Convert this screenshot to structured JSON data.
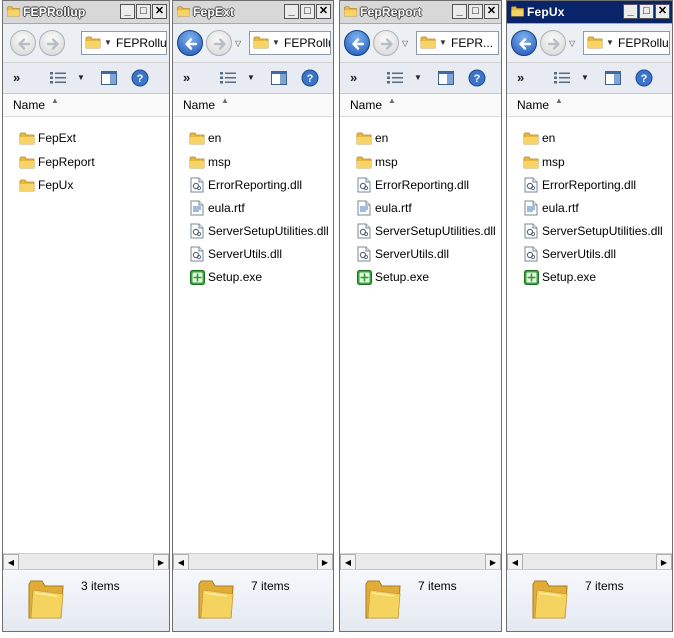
{
  "windows": [
    {
      "title": "FEPRollup",
      "active": false,
      "back_enabled": false,
      "address": "FEPRollup",
      "column_header": "Name",
      "items": [
        {
          "label": "FepExt",
          "type": "folder"
        },
        {
          "label": "FepReport",
          "type": "folder"
        },
        {
          "label": "FepUx",
          "type": "folder"
        }
      ],
      "status_count": "3 items"
    },
    {
      "title": "FepExt",
      "active": false,
      "back_enabled": true,
      "address": "FEPRollu",
      "column_header": "Name",
      "items": [
        {
          "label": "en",
          "type": "folder"
        },
        {
          "label": "msp",
          "type": "folder"
        },
        {
          "label": "ErrorReporting.dll",
          "type": "dll"
        },
        {
          "label": "eula.rtf",
          "type": "rtf"
        },
        {
          "label": "ServerSetupUtilities.dll",
          "type": "dll"
        },
        {
          "label": "ServerUtils.dll",
          "type": "dll"
        },
        {
          "label": "Setup.exe",
          "type": "exe"
        }
      ],
      "status_count": "7 items"
    },
    {
      "title": "FepReport",
      "active": false,
      "back_enabled": true,
      "address": "FEPR...",
      "column_header": "Name",
      "items": [
        {
          "label": "en",
          "type": "folder"
        },
        {
          "label": "msp",
          "type": "folder"
        },
        {
          "label": "ErrorReporting.dll",
          "type": "dll"
        },
        {
          "label": "eula.rtf",
          "type": "rtf"
        },
        {
          "label": "ServerSetupUtilities.dll",
          "type": "dll"
        },
        {
          "label": "ServerUtils.dll",
          "type": "dll"
        },
        {
          "label": "Setup.exe",
          "type": "exe"
        }
      ],
      "status_count": "7 items"
    },
    {
      "title": "FepUx",
      "active": true,
      "back_enabled": true,
      "address": "FEPRollup",
      "column_header": "Name",
      "items": [
        {
          "label": "en",
          "type": "folder"
        },
        {
          "label": "msp",
          "type": "folder"
        },
        {
          "label": "ErrorReporting.dll",
          "type": "dll"
        },
        {
          "label": "eula.rtf",
          "type": "rtf"
        },
        {
          "label": "ServerSetupUtilities.dll",
          "type": "dll"
        },
        {
          "label": "ServerUtils.dll",
          "type": "dll"
        },
        {
          "label": "Setup.exe",
          "type": "exe"
        }
      ],
      "status_count": "7 items"
    }
  ],
  "toolbar": {
    "more_label": "»",
    "help_label": "?"
  },
  "title_buttons": {
    "minimize": "_",
    "maximize": "□",
    "close": "✕"
  },
  "icons": {
    "folder": "folder-icon",
    "dll": "dll-file-icon",
    "rtf": "rtf-file-icon",
    "exe": "setup-exe-icon",
    "back": "back-arrow-icon",
    "forward": "forward-arrow-icon",
    "views": "views-icon",
    "preview_pane": "preview-pane-icon",
    "help": "help-icon"
  },
  "colors": {
    "active_title": "#0a246a",
    "inactive_title": "#d8d8d8",
    "nav_blue": "#1e55b8",
    "exe_green": "#2e9b2e"
  }
}
